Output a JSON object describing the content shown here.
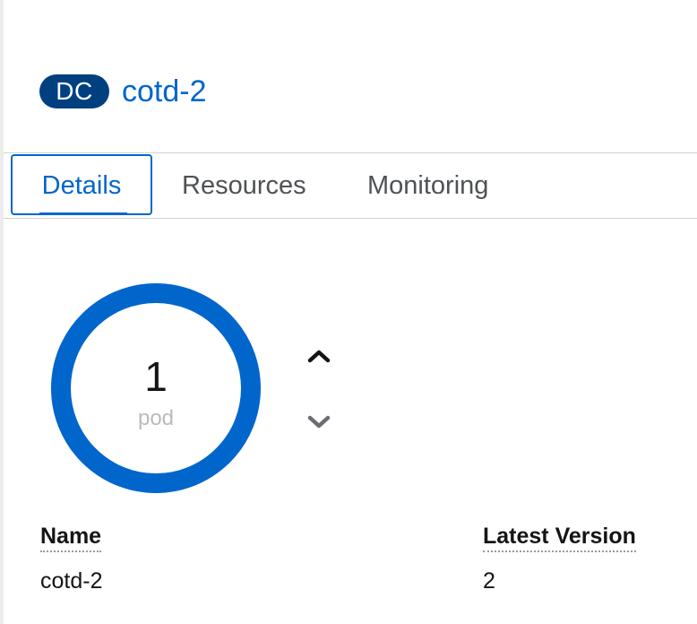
{
  "header": {
    "kind_badge": "DC",
    "title": "cotd-2"
  },
  "tabs": [
    {
      "label": "Details",
      "active": true
    },
    {
      "label": "Resources",
      "active": false
    },
    {
      "label": "Monitoring",
      "active": false
    }
  ],
  "pods": {
    "count": "1",
    "unit": "pod",
    "ring_color": "#0066cc",
    "scale_up_icon": "chevron-up-icon",
    "scale_down_icon": "chevron-down-icon"
  },
  "details": {
    "name_label": "Name",
    "name_value": "cotd-2",
    "latest_version_label": "Latest Version",
    "latest_version_value": "2"
  },
  "colors": {
    "accent": "#0066cc",
    "badge": "#004080"
  }
}
